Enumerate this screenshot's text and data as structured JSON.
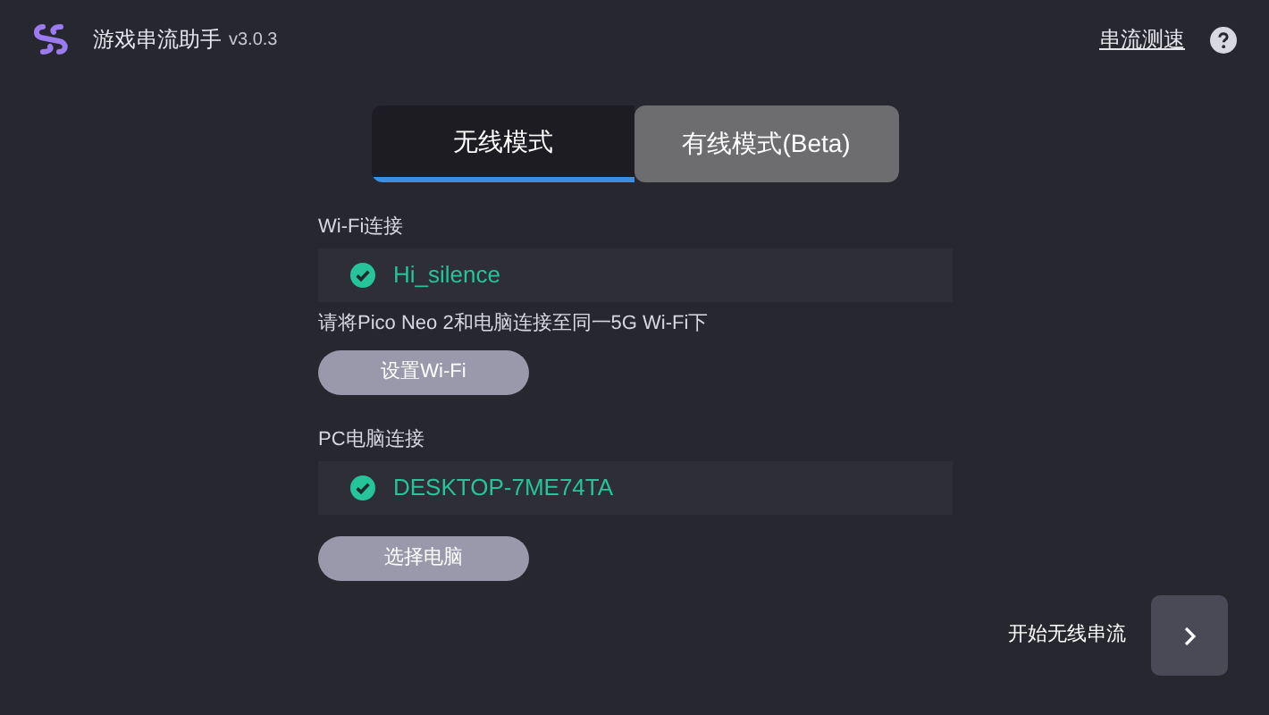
{
  "header": {
    "title": "游戏串流助手",
    "version": "v3.0.3",
    "link": "串流测速"
  },
  "tabs": [
    {
      "label": "无线模式",
      "selected": true
    },
    {
      "label": "有线模式(Beta)",
      "selected": false
    }
  ],
  "sections": [
    {
      "label": "Wi-Fi连接",
      "value": "Hi_silence",
      "connected": true,
      "hint": "请将Pico Neo 2和电脑连接至同一5G Wi-Fi下",
      "button": "设置Wi-Fi"
    },
    {
      "label": "PC电脑连接",
      "value": "DESKTOP-7ME74TA",
      "connected": true,
      "button": "选择电脑"
    }
  ],
  "start": {
    "label": "开始无线串流"
  }
}
